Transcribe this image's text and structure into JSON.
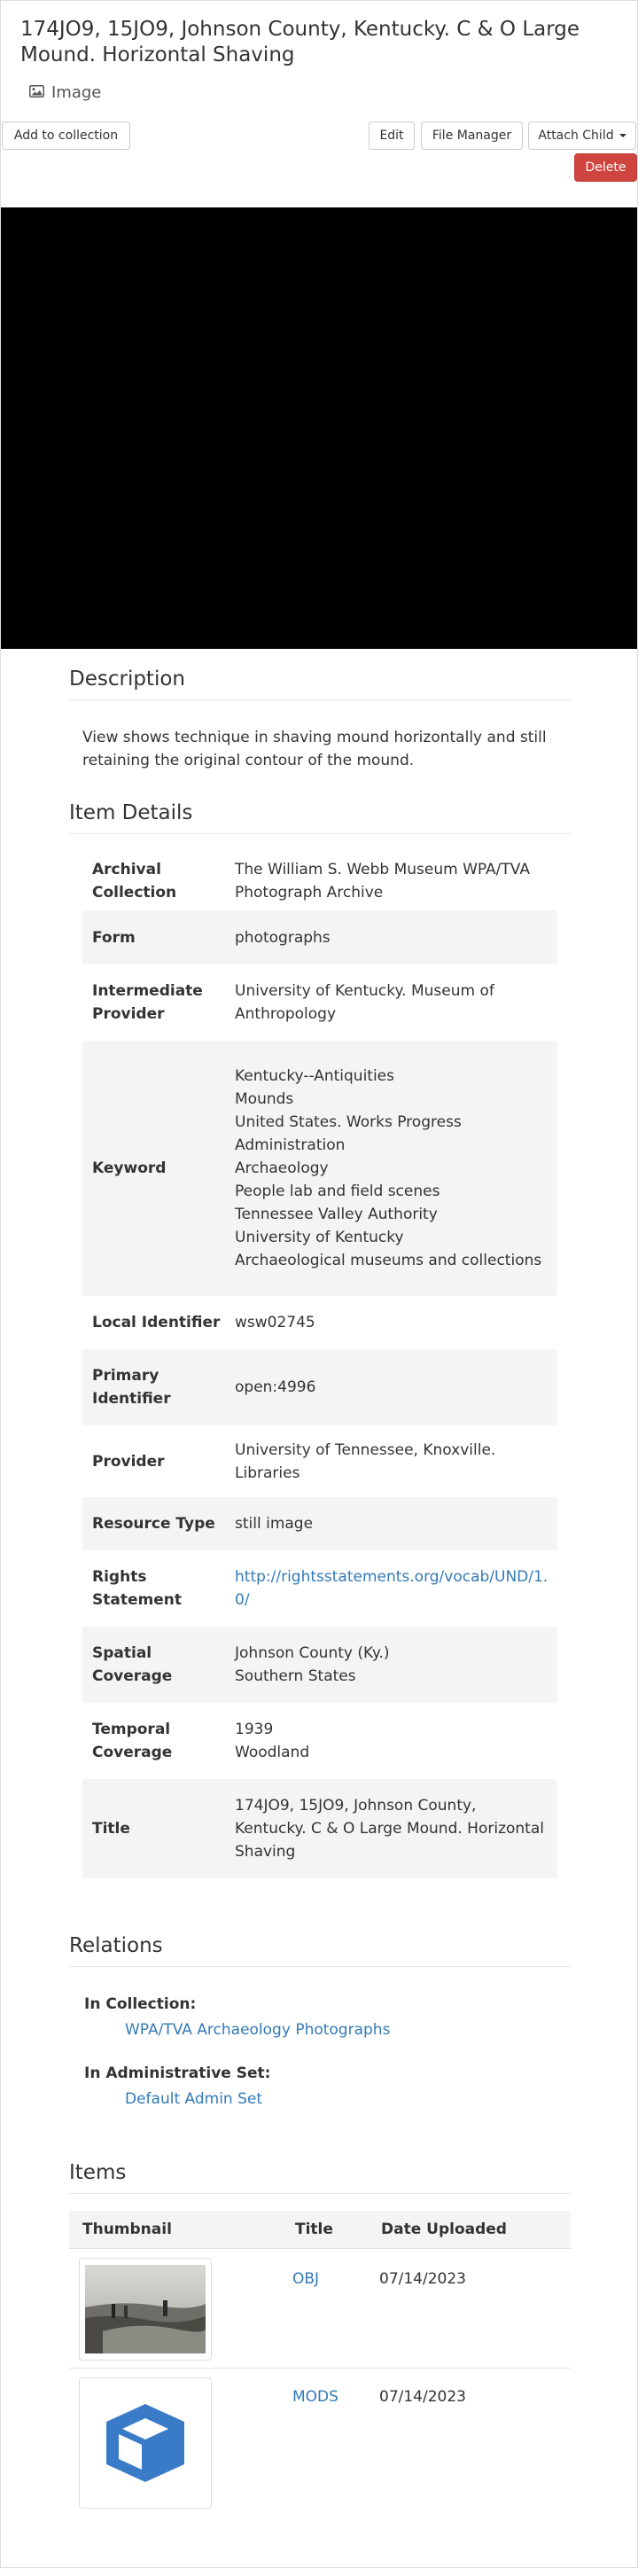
{
  "header": {
    "title": "174JO9, 15JO9, Johnson County, Kentucky. C & O Large Mound. Horizontal Shaving",
    "type_label": "Image",
    "type_icon": "image-icon"
  },
  "actions": {
    "add_to_collection": "Add to collection",
    "edit": "Edit",
    "file_manager": "File Manager",
    "attach_child": "Attach Child",
    "delete": "Delete"
  },
  "colors": {
    "danger": "#d0443f",
    "link": "#337ab7",
    "viewer_bg": "#000000",
    "shade": "#f4f4f4"
  },
  "description": {
    "heading": "Description",
    "text": "View shows technique in shaving mound horizontally and still retaining the original contour of the mound."
  },
  "details": {
    "heading": "Item Details",
    "rows": [
      {
        "label": "Archival Collection",
        "values": [
          "The William S. Webb Museum WPA/TVA Photograph Archive"
        ]
      },
      {
        "label": "Form",
        "values": [
          "photographs"
        ]
      },
      {
        "label": "Intermediate Provider",
        "values": [
          "University of Kentucky. Museum of Anthropology"
        ]
      },
      {
        "label": "Keyword",
        "values": [
          "Kentucky--Antiquities",
          "Mounds",
          "United States. Works Progress Administration",
          "Archaeology",
          "People lab and field scenes",
          "Tennessee Valley Authority",
          "University of Kentucky",
          "Archaeological museums and collections"
        ]
      },
      {
        "label": "Local Identifier",
        "values": [
          "wsw02745"
        ]
      },
      {
        "label": "Primary Identifier",
        "values": [
          "open:4996"
        ]
      },
      {
        "label": "Provider",
        "values": [
          "University of Tennessee, Knoxville. Libraries"
        ]
      },
      {
        "label": "Resource Type",
        "values": [
          "still image"
        ]
      },
      {
        "label": "Rights Statement",
        "values": [
          "http://rightsstatements.org/vocab/UND/1.0/"
        ]
      },
      {
        "label": "Spatial Coverage",
        "values": [
          "Johnson County (Ky.)",
          "Southern States"
        ]
      },
      {
        "label": "Temporal Coverage",
        "values": [
          "1939",
          "Woodland"
        ]
      },
      {
        "label": "Title",
        "values": [
          "174JO9, 15JO9, Johnson County, Kentucky. C & O Large Mound. Horizontal Shaving"
        ]
      }
    ]
  },
  "relations": {
    "heading": "Relations",
    "in_collection_label": "In Collection:",
    "in_collection_value": "WPA/TVA Archaeology Photographs",
    "admin_set_label": "In Administrative Set:",
    "admin_set_value": "Default Admin Set"
  },
  "items": {
    "heading": "Items",
    "columns": [
      "Thumbnail",
      "Title",
      "Date Uploaded"
    ],
    "rows": [
      {
        "thumbnail": "photo-thumbnail",
        "title": "OBJ",
        "date": "07/14/2023"
      },
      {
        "thumbnail": "cube-icon",
        "title": "MODS",
        "date": "07/14/2023"
      }
    ]
  }
}
